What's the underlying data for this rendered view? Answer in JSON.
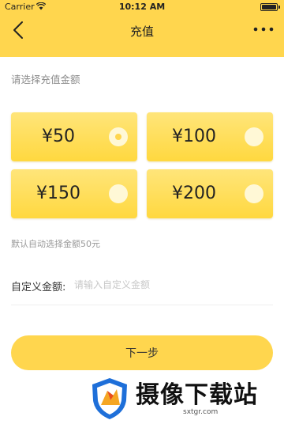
{
  "status_bar": {
    "carrier": "Carrier",
    "time": "10:12 AM"
  },
  "nav": {
    "title": "充值"
  },
  "section_label": "请选择充值金额",
  "amounts": [
    {
      "label": "¥50",
      "selected": true
    },
    {
      "label": "¥100",
      "selected": false
    },
    {
      "label": "¥150",
      "selected": false
    },
    {
      "label": "¥200",
      "selected": false
    }
  ],
  "default_note": "默认自动选择金额50元",
  "custom": {
    "label": "自定义金额:",
    "placeholder": "请输入自定义金额"
  },
  "next_button": "下一步",
  "watermark": {
    "brand": "摄像下载站",
    "url": "sxtgr.com"
  },
  "colors": {
    "accent": "#ffd64e",
    "card_light": "#ffe57a",
    "card_dark": "#ffd83f"
  },
  "icons": [
    "wifi-icon",
    "battery-icon",
    "back-icon",
    "more-icon",
    "radio-icon",
    "logo-icon"
  ]
}
